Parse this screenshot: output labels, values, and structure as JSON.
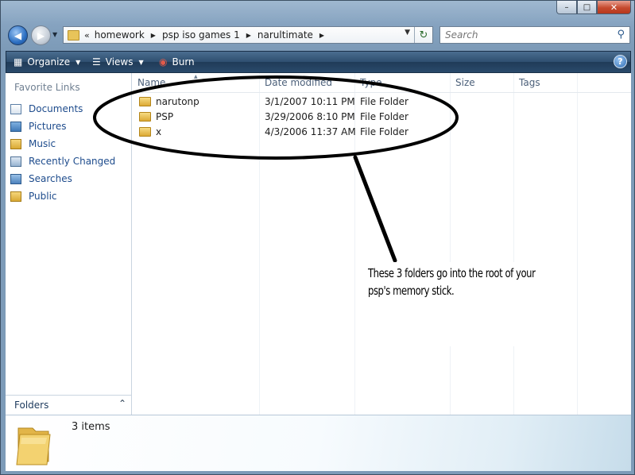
{
  "window": {
    "controls": {
      "minimize": "–",
      "maximize": "□",
      "close": "✕"
    }
  },
  "nav": {
    "back_icon": "back-arrow-icon",
    "forward_icon": "forward-arrow-icon",
    "address": {
      "overflow": "«",
      "path": [
        "homework",
        "psp iso games 1",
        "narultimate"
      ]
    },
    "search": {
      "placeholder": "Search"
    }
  },
  "toolbar": {
    "organize": "Organize",
    "views": "Views",
    "burn": "Burn",
    "help": "?"
  },
  "sidebar": {
    "title": "Favorite Links",
    "links": [
      "Documents",
      "Pictures",
      "Music",
      "Recently Changed",
      "Searches",
      "Public"
    ],
    "folders_label": "Folders"
  },
  "file_list": {
    "columns": [
      "Name",
      "Date modified",
      "Type",
      "Size",
      "Tags"
    ],
    "rows": [
      {
        "name": "narutonp",
        "date": "3/1/2007 10:11 PM",
        "type": "File Folder"
      },
      {
        "name": "PSP",
        "date": "3/29/2006 8:10 PM",
        "type": "File Folder"
      },
      {
        "name": "x",
        "date": "4/3/2006 11:37 AM",
        "type": "File Folder"
      }
    ]
  },
  "annotation": {
    "line1": "These 3 folders go into the root of your",
    "line2": "psp's memory stick."
  },
  "details": {
    "item_count": "3 items"
  },
  "colors": {
    "command_bar": "#2f4f70",
    "link_blue": "#1d4b8c",
    "annotation_ink": "#000000"
  }
}
